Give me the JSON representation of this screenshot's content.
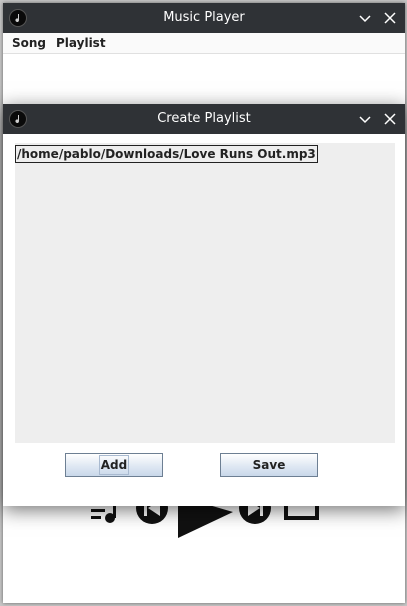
{
  "main_window": {
    "title": "Music Player",
    "menu": [
      "Song",
      "Playlist"
    ]
  },
  "player_controls": {
    "icons": [
      "queue-music-icon",
      "skip-previous-icon",
      "play-icon",
      "skip-next-icon",
      "stop-icon"
    ]
  },
  "dialog": {
    "title": "Create Playlist",
    "entries": [
      "/home/pablo/Downloads/Love Runs Out.mp3"
    ],
    "add_label": "Add",
    "save_label": "Save"
  },
  "colors": {
    "titlebar": "#2f3236",
    "list_background": "#eeeeee"
  }
}
